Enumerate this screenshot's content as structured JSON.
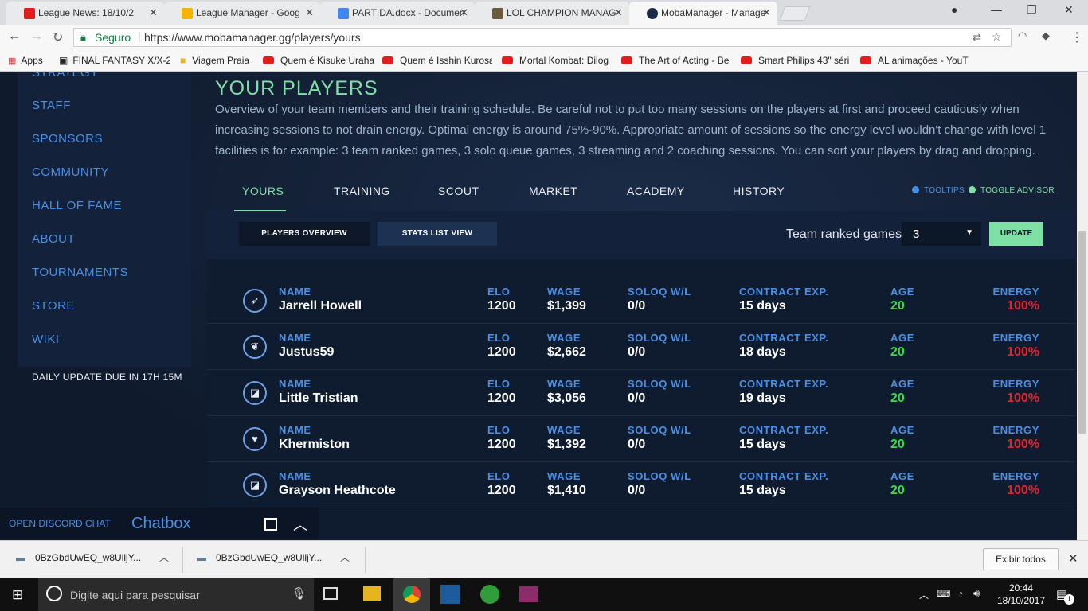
{
  "browser": {
    "tabs": [
      {
        "title": "League News: 18/10/2"
      },
      {
        "title": "League Manager - Goog"
      },
      {
        "title": "PARTIDA.docx - Documen"
      },
      {
        "title": "LOL CHAMPION MANAG"
      },
      {
        "title": "MobaManager - Manage"
      }
    ],
    "secure_label": "Seguro",
    "url": "https://www.mobamanager.gg/players/yours",
    "bookmarks": [
      {
        "label": "Apps"
      },
      {
        "label": "FINAL FANTASY X/X-2"
      },
      {
        "label": "Viagem Praia"
      },
      {
        "label": "Quem é Kisuke Uraha"
      },
      {
        "label": "Quem é Isshin Kurosa"
      },
      {
        "label": "Mortal Kombat: Dilog"
      },
      {
        "label": "The Art of Acting - Be"
      },
      {
        "label": "Smart Philips 43\" séri"
      },
      {
        "label": "AL animações - YouT"
      }
    ]
  },
  "sidebar": {
    "items": [
      {
        "label": "STRATEGY"
      },
      {
        "label": "STAFF"
      },
      {
        "label": "SPONSORS"
      },
      {
        "label": "COMMUNITY"
      },
      {
        "label": "HALL OF FAME"
      },
      {
        "label": "ABOUT"
      },
      {
        "label": "TOURNAMENTS"
      },
      {
        "label": "STORE"
      },
      {
        "label": "WIKI"
      }
    ],
    "daily_update": "DAILY UPDATE DUE IN 17H 15M"
  },
  "main": {
    "title": "YOUR PLAYERS",
    "description": "Overview of your team members and their training schedule. Be careful not to put too many sessions on the players at first and proceed cautiously when increasing sessions to not drain energy. Optimal energy is around 75%-90%. Appropriate amount of sessions so the energy level wouldn't change with level 1 facilities is for example: 3 team ranked games, 3 solo queue games, 3 streaming and 2 coaching sessions. You can sort your players by drag and dropping.",
    "tabs": [
      {
        "label": "YOURS"
      },
      {
        "label": "TRAINING"
      },
      {
        "label": "SCOUT"
      },
      {
        "label": "MARKET"
      },
      {
        "label": "ACADEMY"
      },
      {
        "label": "HISTORY"
      }
    ],
    "tooltips_label": "TOOLTIPS",
    "advisor_label": "TOGGLE ADVISOR",
    "players_overview": "PLAYERS OVERVIEW",
    "stats_list_view": "STATS LIST VIEW",
    "team_ranked_label": "Team ranked games:",
    "team_ranked_value": "3",
    "update_label": "UPDATE",
    "columns": {
      "name": "NAME",
      "elo": "ELO",
      "wage": "WAGE",
      "soloq": "SOLOQ W/L",
      "contract": "CONTRACT EXP.",
      "age": "AGE",
      "energy": "ENERGY"
    },
    "players": [
      {
        "name": "Jarrell Howell",
        "elo": "1200",
        "wage": "$1,399",
        "soloq": "0/0",
        "contract": "15 days",
        "age": "20",
        "energy": "100%",
        "icon": "compass-icon"
      },
      {
        "name": "Justus59",
        "elo": "1200",
        "wage": "$2,662",
        "soloq": "0/0",
        "contract": "18 days",
        "age": "20",
        "energy": "100%",
        "icon": "leaf-icon"
      },
      {
        "name": "Little Tristian",
        "elo": "1200",
        "wage": "$3,056",
        "soloq": "0/0",
        "contract": "19 days",
        "age": "20",
        "energy": "100%",
        "icon": "square-icon"
      },
      {
        "name": "Khermiston",
        "elo": "1200",
        "wage": "$1,392",
        "soloq": "0/0",
        "contract": "15 days",
        "age": "20",
        "energy": "100%",
        "icon": "heart-icon"
      },
      {
        "name": "Grayson Heathcote",
        "elo": "1200",
        "wage": "$1,410",
        "soloq": "0/0",
        "contract": "15 days",
        "age": "20",
        "energy": "100%",
        "icon": "square-icon"
      }
    ]
  },
  "chat": {
    "discord_label": "OPEN DISCORD CHAT",
    "chatbox_label": "Chatbox"
  },
  "downloads": {
    "items": [
      {
        "label": "0BzGbdUwEQ_w8UlljY..."
      },
      {
        "label": "0BzGbdUwEQ_w8UlljY..."
      }
    ],
    "show_all": "Exibir todos"
  },
  "taskbar": {
    "search_placeholder": "Digite aqui para pesquisar",
    "time": "20:44",
    "date": "18/10/2017",
    "notif_count": "1"
  },
  "colors": {
    "accent": "#7ee0a4",
    "link": "#4a8fe6",
    "energy": "#e0252f",
    "age": "#35dd3f"
  }
}
